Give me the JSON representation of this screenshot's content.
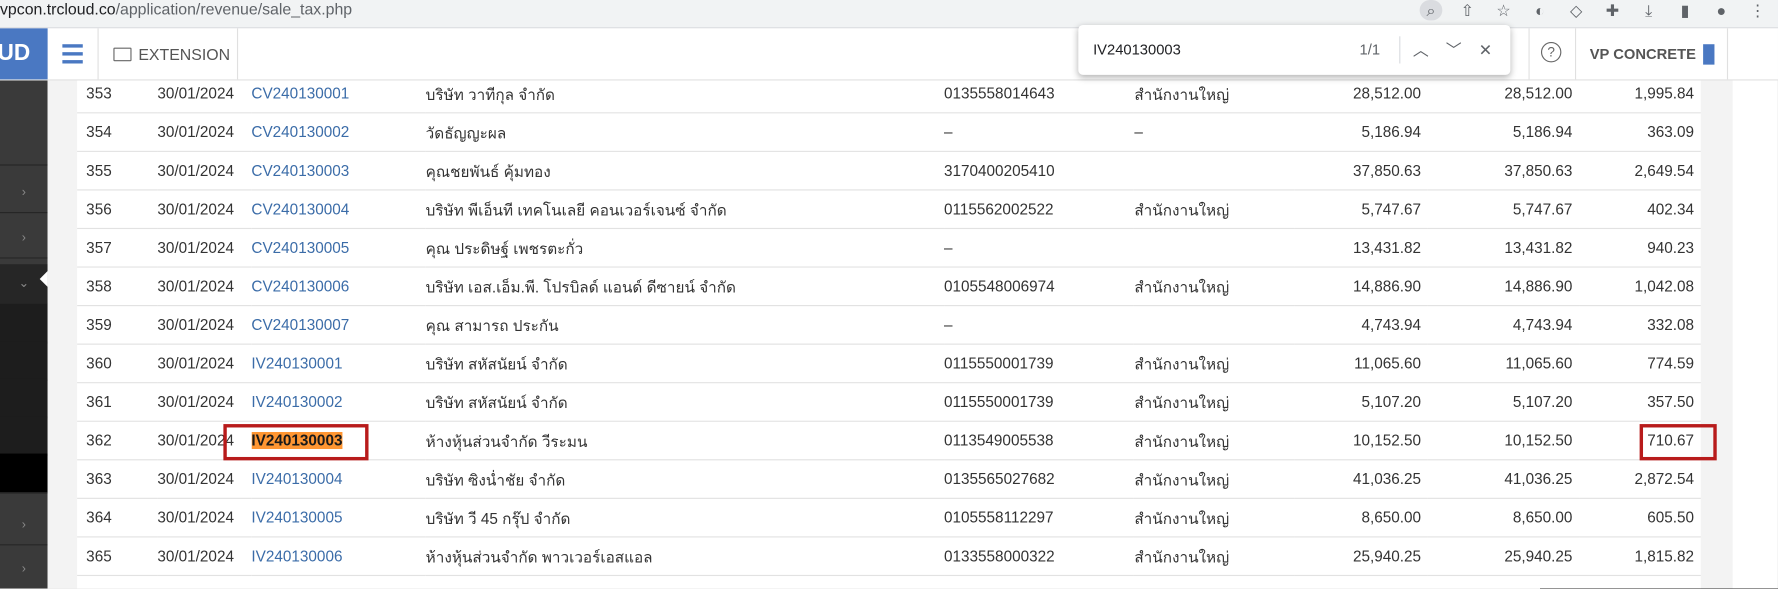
{
  "browser": {
    "url_host": "vpcon.trcloud.co",
    "url_path": "/application/revenue/sale_tax.php"
  },
  "app": {
    "logo_text": "UD",
    "extension_label": "EXTENSION",
    "help_label": "?",
    "company_name": "VP CONCRETE"
  },
  "find": {
    "query": "IV240130003",
    "count": "1/1"
  },
  "rows": [
    {
      "no": "353",
      "date": "30/01/2024",
      "doc": "CV240130001",
      "name": "บริษัท วาทีกุล จำกัด",
      "tax": "0135558014643",
      "branch": "สำนักงานใหญ่",
      "amt1": "28,512.00",
      "amt2": "28,512.00",
      "vat": "1,995.84"
    },
    {
      "no": "354",
      "date": "30/01/2024",
      "doc": "CV240130002",
      "name": "วัดธัญญะผล",
      "tax": "–",
      "branch": "–",
      "amt1": "5,186.94",
      "amt2": "5,186.94",
      "vat": "363.09"
    },
    {
      "no": "355",
      "date": "30/01/2024",
      "doc": "CV240130003",
      "name": "คุณชยพันธ์ คุ้มทอง",
      "tax": "3170400205410",
      "branch": "",
      "amt1": "37,850.63",
      "amt2": "37,850.63",
      "vat": "2,649.54"
    },
    {
      "no": "356",
      "date": "30/01/2024",
      "doc": "CV240130004",
      "name": "บริษัท พีเอ็นที เทคโนเลยี คอนเวอร์เจนซ์ จำกัด",
      "tax": "0115562002522",
      "branch": "สำนักงานใหญ่",
      "amt1": "5,747.67",
      "amt2": "5,747.67",
      "vat": "402.34"
    },
    {
      "no": "357",
      "date": "30/01/2024",
      "doc": "CV240130005",
      "name": "คุณ ประดิษฐ์ เพชรตะกั่ว",
      "tax": "–",
      "branch": "",
      "amt1": "13,431.82",
      "amt2": "13,431.82",
      "vat": "940.23"
    },
    {
      "no": "358",
      "date": "30/01/2024",
      "doc": "CV240130006",
      "name": "บริษัท เอส.เอ็ม.พี. โปรบิลด์ แอนด์ ดีซายน์ จำกัด",
      "tax": "0105548006974",
      "branch": "สำนักงานใหญ่",
      "amt1": "14,886.90",
      "amt2": "14,886.90",
      "vat": "1,042.08"
    },
    {
      "no": "359",
      "date": "30/01/2024",
      "doc": "CV240130007",
      "name": "คุณ สามารถ ประกัน",
      "tax": "–",
      "branch": "",
      "amt1": "4,743.94",
      "amt2": "4,743.94",
      "vat": "332.08"
    },
    {
      "no": "360",
      "date": "30/01/2024",
      "doc": "IV240130001",
      "name": "บริษัท สหัสนัยน์ จำกัด",
      "tax": "0115550001739",
      "branch": "สำนักงานใหญ่",
      "amt1": "11,065.60",
      "amt2": "11,065.60",
      "vat": "774.59"
    },
    {
      "no": "361",
      "date": "30/01/2024",
      "doc": "IV240130002",
      "name": "บริษัท สหัสนัยน์ จำกัด",
      "tax": "0115550001739",
      "branch": "สำนักงานใหญ่",
      "amt1": "5,107.20",
      "amt2": "5,107.20",
      "vat": "357.50"
    },
    {
      "no": "362",
      "date": "30/01/2024",
      "doc": "IV240130003",
      "name": "ห้างหุ้นส่วนจำกัด วีระมน",
      "tax": "0113549005538",
      "branch": "สำนักงานใหญ่",
      "amt1": "10,152.50",
      "amt2": "10,152.50",
      "vat": "710.67"
    },
    {
      "no": "363",
      "date": "30/01/2024",
      "doc": "IV240130004",
      "name": "บริษัท ซิงน่ำชัย จำกัด",
      "tax": "0135565027682",
      "branch": "สำนักงานใหญ่",
      "amt1": "41,036.25",
      "amt2": "41,036.25",
      "vat": "2,872.54"
    },
    {
      "no": "364",
      "date": "30/01/2024",
      "doc": "IV240130005",
      "name": "บริษัท วี 45 กรุ๊ป จำกัด",
      "tax": "0105558112297",
      "branch": "สำนักงานใหญ่",
      "amt1": "8,650.00",
      "amt2": "8,650.00",
      "vat": "605.50"
    },
    {
      "no": "365",
      "date": "30/01/2024",
      "doc": "IV240130006",
      "name": "ห้างหุ้นส่วนจำกัด พาวเวอร์เอสแอล",
      "tax": "0133558000322",
      "branch": "สำนักงานใหญ่",
      "amt1": "25,940.25",
      "amt2": "25,940.25",
      "vat": "1,815.82"
    }
  ],
  "icons": {
    "browser": [
      "search-page-icon",
      "share-icon",
      "star-icon",
      "extension-chat-icon",
      "shield-icon",
      "puzzle-icon",
      "download-icon",
      "sidepanel-icon",
      "profile-icon",
      "kebab-menu-icon"
    ],
    "find": [
      "chevron-up-icon",
      "chevron-down-icon",
      "close-icon"
    ],
    "sidebar": [
      "chevron-right-icon",
      "chevron-down-icon"
    ]
  },
  "colors": {
    "brand": "#4a78c2",
    "link": "#3b6ca8",
    "find_highlight": "#ff9632",
    "annotation_box": "#b81b1b"
  }
}
